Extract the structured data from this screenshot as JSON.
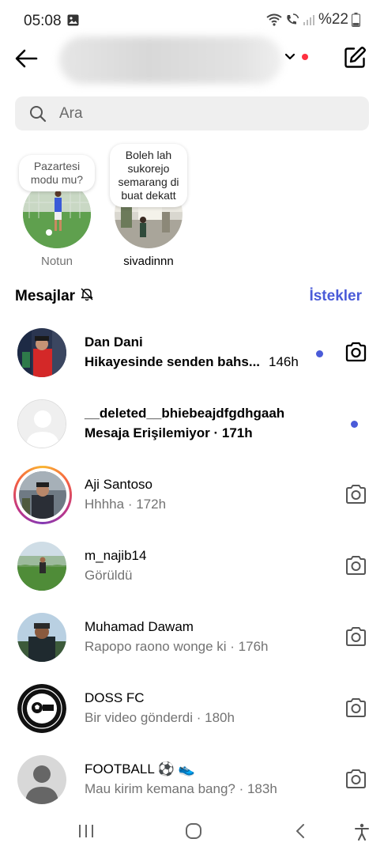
{
  "status_bar": {
    "time": "05:08",
    "battery": "%22",
    "icons": [
      "gallery-icon",
      "wifi-icon",
      "wifi-call-icon",
      "signal-icon",
      "battery-icon"
    ]
  },
  "topbar": {
    "username": "",
    "icons": [
      "back-arrow-icon",
      "chevron-down-icon",
      "compose-icon"
    ]
  },
  "search": {
    "placeholder": "Ara"
  },
  "notes": [
    {
      "text": "Pazartesi modu mu?",
      "name": "Notun"
    },
    {
      "text": "Boleh lah sukorejo semarang di buat dekatt",
      "name": "sivadinnn"
    }
  ],
  "messages_header": {
    "title": "Mesajlar",
    "requests": "İstekler",
    "icon": "mute-bell-icon"
  },
  "threads": [
    {
      "name": "Dan Dani",
      "preview": "Hikayesinde senden bahs...",
      "time": "146h",
      "unread": true,
      "camera": true
    },
    {
      "name": "__deleted__bhiebeajdfgdhgaah",
      "preview": "Mesaja Erişilemiyor · 171h",
      "unread": true,
      "camera": false
    },
    {
      "name": "Aji Santoso",
      "preview": "Hhhha · 172h",
      "unread": false,
      "camera": true,
      "story_ring": true
    },
    {
      "name": "m_najib14",
      "preview": "Görüldü",
      "unread": false,
      "camera": true
    },
    {
      "name": "Muhamad Dawam",
      "preview": "Rapopo raono wonge ki · 176h",
      "unread": false,
      "camera": true
    },
    {
      "name": "DOSS FC",
      "preview": "Bir video gönderdi · 180h",
      "unread": false,
      "camera": true
    },
    {
      "name": "FOOTBALL ⚽ 👟",
      "preview": "Mau kirim kemana bang? · 183h",
      "unread": false,
      "camera": true
    }
  ],
  "nav_bar": {
    "icons": [
      "recent-apps-icon",
      "home-icon",
      "back-icon",
      "accessibility-icon"
    ]
  },
  "colors": {
    "accent": "#4a5bd8",
    "unread_dot": "#4a5bd8",
    "notification_dot": "#ff3040",
    "secondary_text": "#737373"
  }
}
